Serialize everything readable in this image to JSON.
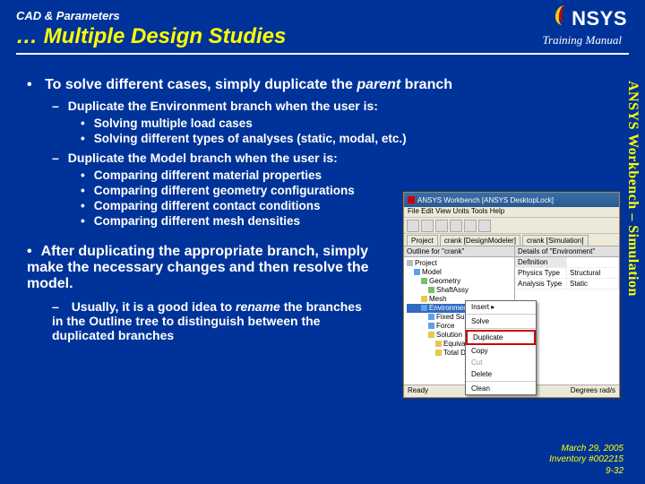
{
  "header": {
    "eyebrow": "CAD & Parameters",
    "title": "… Multiple Design Studies",
    "training_manual": "Training Manual",
    "logo_text": "NSYS"
  },
  "side_label": "ANSYS Workbench – Simulation",
  "bullets": {
    "solve_intro_pre": "To solve different cases, simply duplicate the ",
    "solve_intro_em": "parent",
    "solve_intro_post": " branch",
    "env_branch": "Duplicate the Environment branch when the user is:",
    "env_items": [
      "Solving multiple load cases",
      "Solving different types of analyses (static, modal, etc.)"
    ],
    "model_branch": "Duplicate the Model branch when the user is:",
    "model_items": [
      "Comparing different material properties",
      "Comparing different geometry configurations",
      "Comparing different contact conditions",
      "Comparing different mesh densities"
    ],
    "after": "After duplicating the appropriate branch, simply make the necessary changes and then resolve the model.",
    "usually_pre": "Usually, it is a good idea to ",
    "usually_em": "rename",
    "usually_post": " the branches in the Outline tree to distinguish between the duplicated branches"
  },
  "screenshot": {
    "title": "ANSYS Workbench [ANSYS DesktopLock]",
    "menubar": "File  Edit  View  Units  Tools  Help",
    "tabs": [
      "Project",
      "crank [DesignModeler]",
      "crank [Simulation]"
    ],
    "outline_header": "Outline for \"crank\"",
    "tree": {
      "root": "Project",
      "model": "Model",
      "geometry": "Geometry",
      "part": "ShaftAssy",
      "mesh": "Mesh",
      "environment": "Environment",
      "fixed": "Fixed Support",
      "force": "Force",
      "solution": "Solution",
      "eqv": "Equivalent Stress",
      "tot": "Total Deformation"
    },
    "context_menu": {
      "insert": "Insert",
      "solve": "Solve",
      "duplicate": "Duplicate",
      "copy": "Copy",
      "cut": "Cut",
      "delete": "Delete",
      "clean": "Clean"
    },
    "details_header": "Details of \"Environment\"",
    "grid_rows": [
      [
        "Definition",
        ""
      ],
      [
        "Physics Type",
        "Structural"
      ],
      [
        "Analysis Type",
        "Static"
      ]
    ],
    "status_left": "Ready",
    "status_right": "Degrees  rad/s"
  },
  "footer": {
    "date": "March 29, 2005",
    "inventory": "Inventory #002215",
    "page": "9-32"
  }
}
